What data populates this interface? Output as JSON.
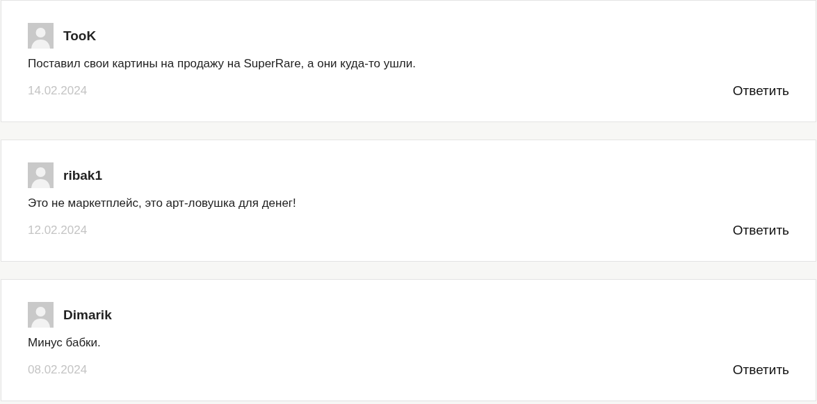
{
  "comments": [
    {
      "author": "TooK",
      "text": "Поставил свои картины на продажу на SuperRare, а они куда-то ушли.",
      "date": "14.02.2024",
      "reply": "Ответить"
    },
    {
      "author": "ribak1",
      "text": "Это не маркетплейс, это арт-ловушка для денег!",
      "date": "12.02.2024",
      "reply": "Ответить"
    },
    {
      "author": "Dimarik",
      "text": "Минус бабки.",
      "date": "08.02.2024",
      "reply": "Ответить"
    }
  ]
}
